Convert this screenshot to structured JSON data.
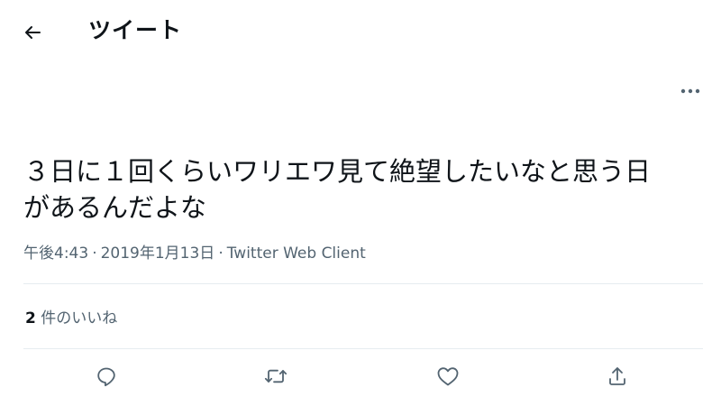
{
  "header": {
    "back_icon": "arrow-left-icon",
    "title": "ツイート"
  },
  "tweet": {
    "more_icon": "more-horizontal-icon",
    "text_line1": "３日に１回くらいワリエワ見て絶望したいなと思う日",
    "text_line2": "があるんだよな",
    "time": "午後4:43",
    "separator1": "·",
    "date": "2019年1月13日",
    "separator2": "·",
    "client": "Twitter Web Client"
  },
  "stats": {
    "likes_count": "2",
    "likes_label": "件のいいね"
  },
  "actions": {
    "reply_icon": "reply-icon",
    "retweet_icon": "retweet-icon",
    "like_icon": "heart-icon",
    "share_icon": "share-icon"
  },
  "colors": {
    "text": "#0f1419",
    "secondary": "#536471",
    "divider": "#e6ecf0"
  }
}
